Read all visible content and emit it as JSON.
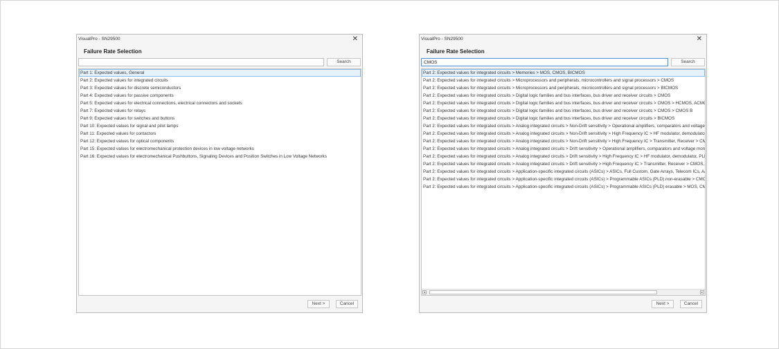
{
  "dialogs": [
    {
      "window_title": "VisualPro - SN29500",
      "close": "✕",
      "heading": "Failure Rate Selection",
      "search_value": "",
      "search_button": "Search",
      "next": "Next >",
      "cancel": "Cancel",
      "has_hscroll": false,
      "items": [
        "Part 1: Expected values, General",
        "Part 2: Expected values for integrated circuits",
        "Part 3: Expected values for discrete semiconductors",
        "Part 4: Expected values for passive components",
        "Part 5: Expected values for electrical connections, electrical connectors and sockets",
        "Part 7: Expected values for relays",
        "Part 9: Expected values for switches and buttons",
        "Part 10: Expected values for signal and pilot lamps",
        "Part 11: Expected values for contactors",
        "Part 12: Expected values for optical components",
        "Part 15: Expected values for electromechanical protection devices in low voltage networks",
        "Part 16: Expected values for electromechanical Pushbuttons, Signaling Devices and Position Switches in Low Voltage Networks"
      ]
    },
    {
      "window_title": "VisualPro - SN29500",
      "close": "✕",
      "heading": "Failure Rate Selection",
      "search_value": "CMOS",
      "search_button": "Search",
      "next": "Next >",
      "cancel": "Cancel",
      "has_hscroll": true,
      "scroll_left": "◂",
      "scroll_right": "▸",
      "items": [
        "Part 2: Expected values for integrated circuits > Memories > MOS, CMOS, BICMOS",
        "Part 2: Expected values for integrated circuits > Microprocessors and peripherals, microcontrollers and signal processors > CMOS",
        "Part 2: Expected values for integrated circuits > Microprocessors and peripherals, microcontrollers and signal processors > BICMOS",
        "Part 2: Expected values for integrated circuits > Digital logic families and bus interfaces, bus driver and receiver circuits > CMOS",
        "Part 2: Expected values for integrated circuits > Digital logic families and bus interfaces, bus driver and receiver circuits > CMOS > HCMOS, ACMOS",
        "Part 2: Expected values for integrated circuits > Digital logic families and bus interfaces, bus driver and receiver circuits > CMOS > CMOS B",
        "Part 2: Expected values for integrated circuits > Digital logic families and bus interfaces, bus driver and receiver circuits > BICMOS",
        "Part 2: Expected values for integrated circuits > Analog integrated circuits > Non-Drift sensitivity > Operational amplifiers, comparators and voltage monitors",
        "Part 2: Expected values for integrated circuits > Analog integrated circuits > Non-Drift sensitivity > High Frequency IC > HF modulator, demodulator, PLL",
        "Part 2: Expected values for integrated circuits > Analog integrated circuits > Non-Drift sensitivity > High Frequency IC > Transmitter, Receiver > CMOS, BICMOS",
        "Part 2: Expected values for integrated circuits > Analog integrated circuits > Drift sensitivity > Operational amplifiers, comparators and voltage monitors",
        "Part 2: Expected values for integrated circuits > Analog integrated circuits > Drift sensitivity > High Frequency IC > HF modulator, demodulator, PLL, ...",
        "Part 2: Expected values for integrated circuits > Analog integrated circuits > Drift sensitivity > High Frequency IC > Transmitter, Receiver > CMOS, BICMOS",
        "Part 2: Expected values for integrated circuits > Application-specific integrated circuits (ASICs) > ASICs, Full Custom, Gate Arrays, Telecom ICs, A/D-Converter",
        "Part 2: Expected values for integrated circuits > Application-specific integrated circuits (ASICs) > Programmable ASICs (PLD) non-erasable > CMOS (anti-fuse)",
        "Part 2: Expected values for integrated circuits > Application-specific integrated circuits (ASICs) > Programmable ASICs (PLD) erasable > MOS, CMOS"
      ]
    }
  ]
}
